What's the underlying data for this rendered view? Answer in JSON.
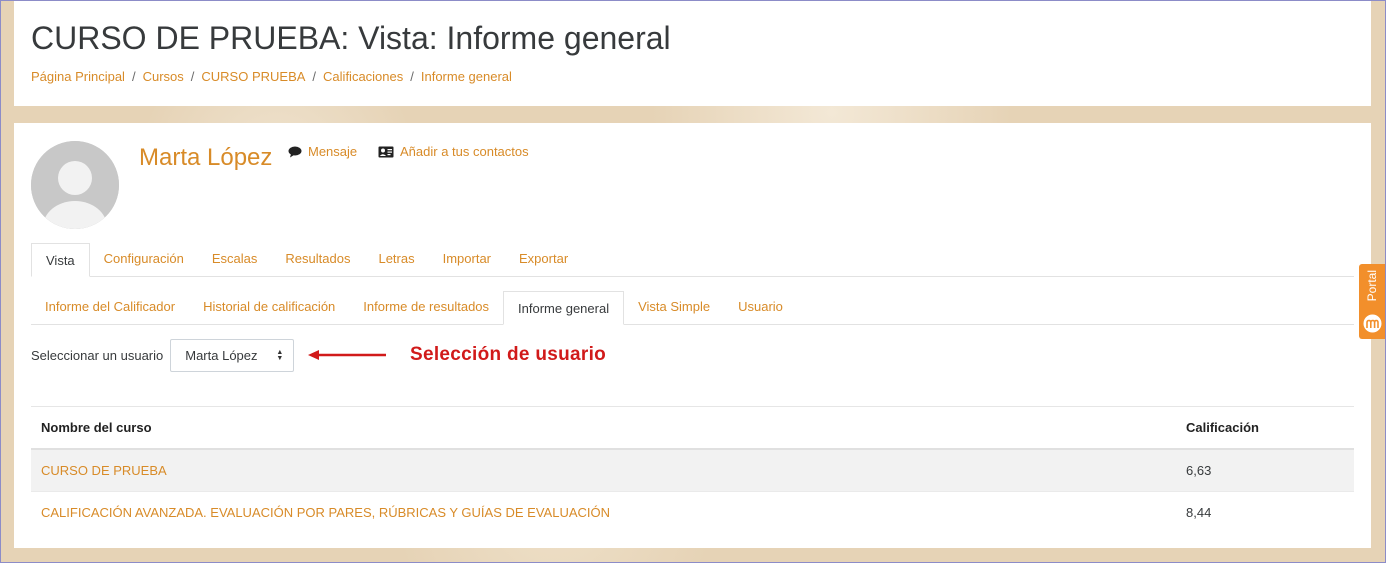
{
  "header": {
    "title": "CURSO DE PRUEBA: Vista: Informe general",
    "breadcrumb": [
      "Página Principal",
      "Cursos",
      "CURSO PRUEBA",
      "Calificaciones",
      "Informe general"
    ],
    "separator": "/"
  },
  "user": {
    "name": "Marta López",
    "message_label": "Mensaje",
    "add_contact_label": "Añadir a tus contactos"
  },
  "tabs_primary": [
    {
      "label": "Vista",
      "active": true
    },
    {
      "label": "Configuración",
      "active": false
    },
    {
      "label": "Escalas",
      "active": false
    },
    {
      "label": "Resultados",
      "active": false
    },
    {
      "label": "Letras",
      "active": false
    },
    {
      "label": "Importar",
      "active": false
    },
    {
      "label": "Exportar",
      "active": false
    }
  ],
  "tabs_secondary": [
    {
      "label": "Informe del Calificador",
      "active": false
    },
    {
      "label": "Historial de calificación",
      "active": false
    },
    {
      "label": "Informe de resultados",
      "active": false
    },
    {
      "label": "Informe general",
      "active": true
    },
    {
      "label": "Vista Simple",
      "active": false
    },
    {
      "label": "Usuario",
      "active": false
    }
  ],
  "selector": {
    "label": "Seleccionar un usuario",
    "value": "Marta López",
    "annotation": "Selección de usuario"
  },
  "table": {
    "headers": {
      "course": "Nombre del curso",
      "grade": "Calificación"
    },
    "rows": [
      {
        "course": "CURSO DE PRUEBA",
        "grade": "6,63"
      },
      {
        "course": "CALIFICACIÓN AVANZADA. EVALUACIÓN POR PARES, RÚBRICAS Y GUÍAS DE EVALUACIÓN",
        "grade": "8,44"
      }
    ]
  },
  "portal": {
    "label": "Portal"
  },
  "colors": {
    "link": "#d88b28",
    "annotation": "#d11a1a",
    "portal": "#f28f2b"
  }
}
